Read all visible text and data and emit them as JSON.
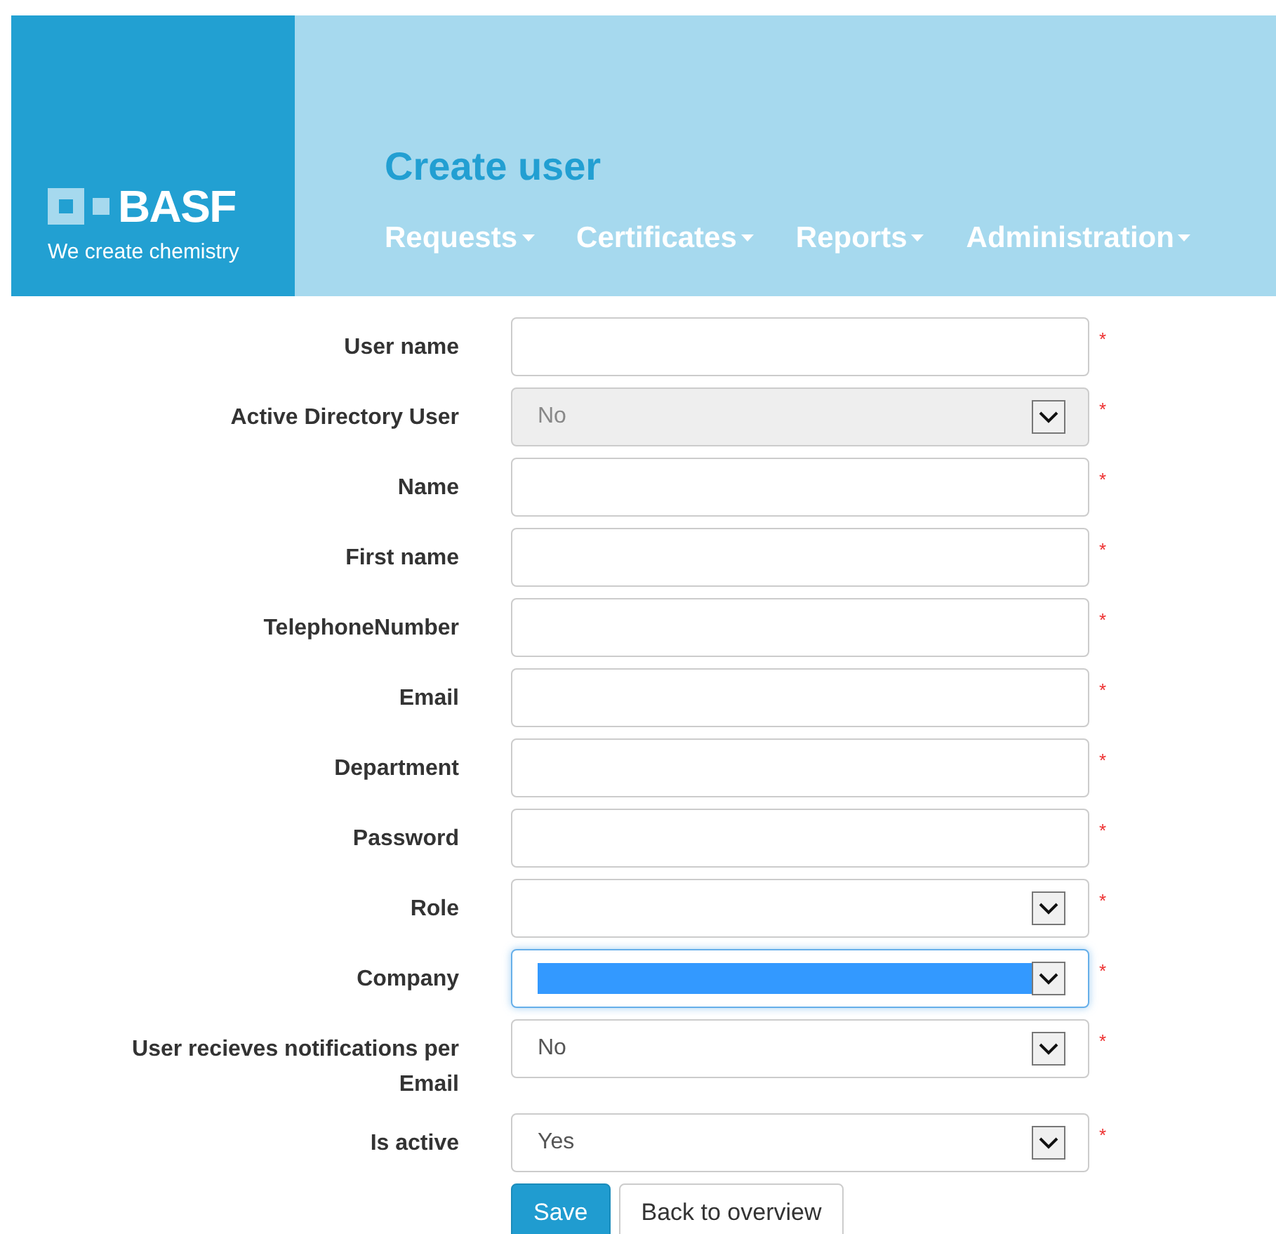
{
  "header": {
    "logo": {
      "name": "BASF",
      "tagline": "We create chemistry"
    },
    "title": "Create user",
    "nav": [
      {
        "label": "Requests"
      },
      {
        "label": "Certificates"
      },
      {
        "label": "Reports"
      },
      {
        "label": "Administration"
      }
    ]
  },
  "form": {
    "fields": [
      {
        "label": "User name",
        "kind": "text",
        "required_mark": "*"
      },
      {
        "label": "Active Directory User",
        "kind": "select",
        "value": "No",
        "disabled": true,
        "focused": false,
        "required_mark": "*"
      },
      {
        "label": "Name",
        "kind": "text",
        "required_mark": "*"
      },
      {
        "label": "First name",
        "kind": "text",
        "required_mark": "*"
      },
      {
        "label": "TelephoneNumber",
        "kind": "text",
        "required_mark": "*"
      },
      {
        "label": "Email",
        "kind": "text",
        "required_mark": "*"
      },
      {
        "label": "Department",
        "kind": "text",
        "required_mark": "*"
      },
      {
        "label": "Password",
        "kind": "text",
        "required_mark": "*"
      },
      {
        "label": "Role",
        "kind": "select",
        "disabled": false,
        "focused": false,
        "required_mark": "*"
      },
      {
        "label": "Company",
        "kind": "select",
        "disabled": false,
        "focused": true,
        "required_mark": "*"
      },
      {
        "label": "User recieves notifications per Email",
        "kind": "select",
        "value": "No",
        "disabled": false,
        "focused": false,
        "required_mark": "*"
      },
      {
        "label": "Is active",
        "kind": "select",
        "value": "Yes",
        "disabled": false,
        "focused": false,
        "required_mark": "*"
      }
    ],
    "buttons": [
      {
        "label": "Save",
        "kind": "primary"
      },
      {
        "label": "Back to overview",
        "kind": "default"
      }
    ]
  }
}
